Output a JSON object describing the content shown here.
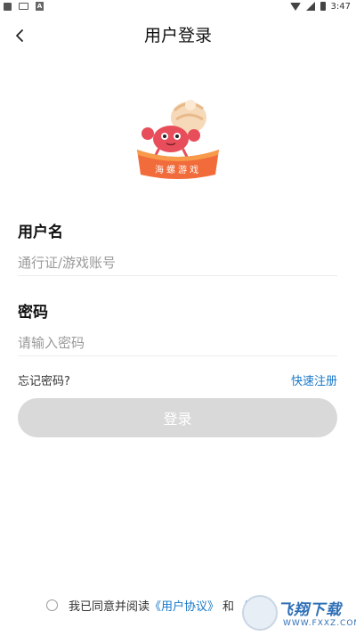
{
  "status_bar": {
    "time": "3:47"
  },
  "header": {
    "title": "用户登录"
  },
  "logo": {
    "banner_text": "海螺游戏"
  },
  "username": {
    "label": "用户名",
    "placeholder": "通行证/游戏账号"
  },
  "password": {
    "label": "密码",
    "placeholder": "请输入密码"
  },
  "links": {
    "forgot": "忘记密码?",
    "register": "快速注册"
  },
  "login_button": {
    "label": "登录"
  },
  "agreement": {
    "prefix": "我已同意并阅读",
    "user_agreement": "《用户协议》",
    "and": "和",
    "privacy": "《"
  },
  "watermark": {
    "title": "飞翔下载",
    "url": "WWW.FXXZ.COM"
  },
  "colors": {
    "link": "#1677c9",
    "button_disabled": "#d9d9d9",
    "logo_banner": "#f26b3a"
  }
}
